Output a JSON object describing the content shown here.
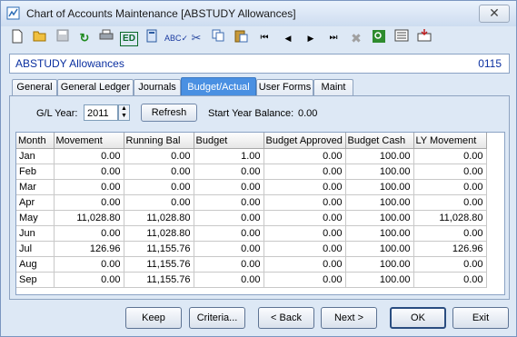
{
  "window": {
    "title": "Chart of Accounts Maintenance  [ABSTUDY Allowances]",
    "close_glyph": "✕"
  },
  "toolbar": {
    "icons": [
      "new-icon",
      "open-icon",
      "save-icon",
      "refresh-icon",
      "print-icon",
      "edit-icon",
      "calculator-icon",
      "spellcheck-icon",
      "cut-icon",
      "copy-icon",
      "paste-icon",
      "first-record-icon",
      "previous-record-icon",
      "next-record-icon",
      "last-record-icon",
      "delete-icon",
      "find-icon",
      "report-icon",
      "export-icon"
    ]
  },
  "header": {
    "account_name": "ABSTUDY Allowances",
    "account_code": "0115"
  },
  "tabs": [
    "General",
    "General Ledger",
    "Journals",
    "Budget/Actual",
    "User Forms",
    "Maint"
  ],
  "active_tab": "Budget/Actual",
  "filter": {
    "year_label": "G/L Year:",
    "year_value": "2011",
    "refresh_label": "Refresh",
    "start_balance_label": "Start Year Balance:",
    "start_balance_value": "0.00"
  },
  "grid": {
    "columns": [
      "Month",
      "Movement",
      "Running Bal",
      "Budget",
      "Budget Approved",
      "Budget Cash",
      "LY Movement"
    ],
    "rows": [
      [
        "Jan",
        "0.00",
        "0.00",
        "1.00",
        "0.00",
        "100.00",
        "0.00"
      ],
      [
        "Feb",
        "0.00",
        "0.00",
        "0.00",
        "0.00",
        "100.00",
        "0.00"
      ],
      [
        "Mar",
        "0.00",
        "0.00",
        "0.00",
        "0.00",
        "100.00",
        "0.00"
      ],
      [
        "Apr",
        "0.00",
        "0.00",
        "0.00",
        "0.00",
        "100.00",
        "0.00"
      ],
      [
        "May",
        "11,028.80",
        "11,028.80",
        "0.00",
        "0.00",
        "100.00",
        "11,028.80"
      ],
      [
        "Jun",
        "0.00",
        "11,028.80",
        "0.00",
        "0.00",
        "100.00",
        "0.00"
      ],
      [
        "Jul",
        "126.96",
        "11,155.76",
        "0.00",
        "0.00",
        "100.00",
        "126.96"
      ],
      [
        "Aug",
        "0.00",
        "11,155.76",
        "0.00",
        "0.00",
        "100.00",
        "0.00"
      ],
      [
        "Sep",
        "0.00",
        "11,155.76",
        "0.00",
        "0.00",
        "100.00",
        "0.00"
      ]
    ]
  },
  "buttons": {
    "keep": "Keep",
    "criteria": "Criteria...",
    "back": "< Back",
    "next": "Next >",
    "ok": "OK",
    "exit": "Exit"
  }
}
